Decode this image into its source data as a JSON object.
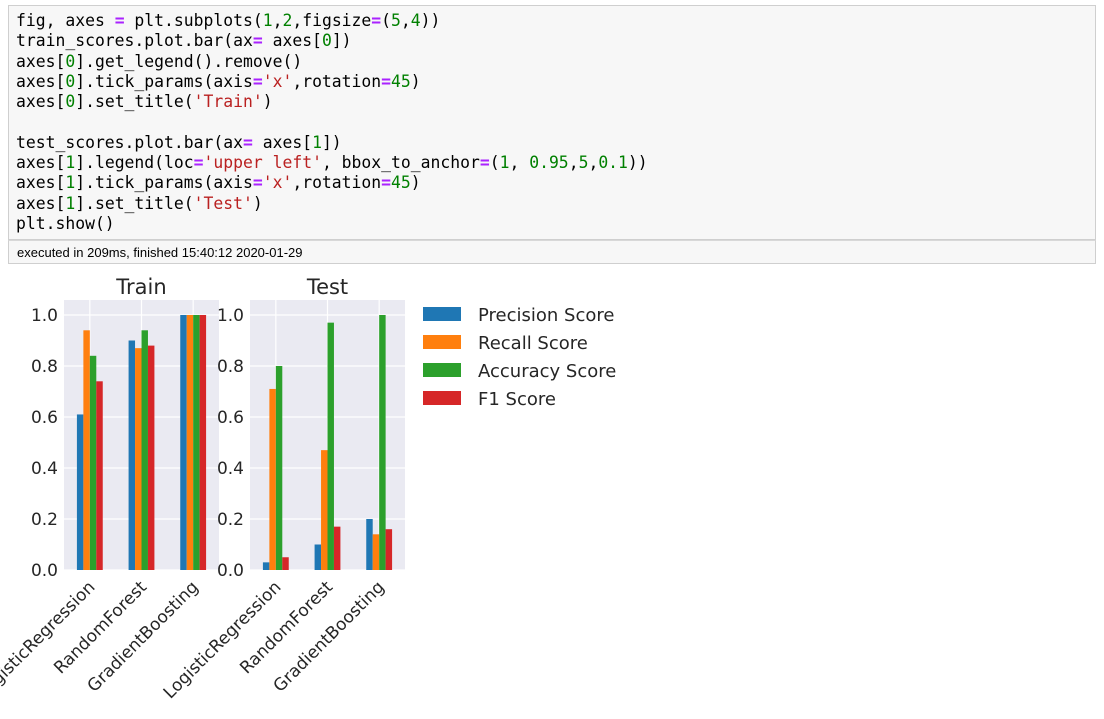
{
  "code_cell": {
    "lines": [
      [
        [
          "fig, axes ",
          "plain"
        ],
        [
          "=",
          "op"
        ],
        [
          " plt.subplots(",
          "plain"
        ],
        [
          "1",
          "num"
        ],
        [
          ",",
          "plain"
        ],
        [
          "2",
          "num"
        ],
        [
          ",figsize",
          "plain"
        ],
        [
          "=",
          "op"
        ],
        [
          "(",
          "plain"
        ],
        [
          "5",
          "num"
        ],
        [
          ",",
          "plain"
        ],
        [
          "4",
          "num"
        ],
        [
          "))",
          "plain"
        ]
      ],
      [
        [
          "train_scores.plot.bar(ax",
          "plain"
        ],
        [
          "=",
          "op"
        ],
        [
          " axes[",
          "plain"
        ],
        [
          "0",
          "num"
        ],
        [
          "])",
          "plain"
        ]
      ],
      [
        [
          "axes[",
          "plain"
        ],
        [
          "0",
          "num"
        ],
        [
          "].get_legend().remove()",
          "plain"
        ]
      ],
      [
        [
          "axes[",
          "plain"
        ],
        [
          "0",
          "num"
        ],
        [
          "].tick_params(axis",
          "plain"
        ],
        [
          "=",
          "op"
        ],
        [
          "'x'",
          "str"
        ],
        [
          ",rotation",
          "plain"
        ],
        [
          "=",
          "op"
        ],
        [
          "45",
          "num"
        ],
        [
          ")",
          "plain"
        ]
      ],
      [
        [
          "axes[",
          "plain"
        ],
        [
          "0",
          "num"
        ],
        [
          "].set_title(",
          "plain"
        ],
        [
          "'Train'",
          "str"
        ],
        [
          ")",
          "plain"
        ]
      ],
      [
        [
          "",
          "plain"
        ]
      ],
      [
        [
          "test_scores.plot.bar(ax",
          "plain"
        ],
        [
          "=",
          "op"
        ],
        [
          " axes[",
          "plain"
        ],
        [
          "1",
          "num"
        ],
        [
          "])",
          "plain"
        ]
      ],
      [
        [
          "axes[",
          "plain"
        ],
        [
          "1",
          "num"
        ],
        [
          "].legend(loc",
          "plain"
        ],
        [
          "=",
          "op"
        ],
        [
          "'upper left'",
          "str"
        ],
        [
          ", bbox_to_anchor",
          "plain"
        ],
        [
          "=",
          "op"
        ],
        [
          "(",
          "plain"
        ],
        [
          "1",
          "num"
        ],
        [
          ", ",
          "plain"
        ],
        [
          "0.95",
          "num"
        ],
        [
          ",",
          "plain"
        ],
        [
          "5",
          "num"
        ],
        [
          ",",
          "plain"
        ],
        [
          "0.1",
          "num"
        ],
        [
          "))",
          "plain"
        ]
      ],
      [
        [
          "axes[",
          "plain"
        ],
        [
          "1",
          "num"
        ],
        [
          "].tick_params(axis",
          "plain"
        ],
        [
          "=",
          "op"
        ],
        [
          "'x'",
          "str"
        ],
        [
          ",rotation",
          "plain"
        ],
        [
          "=",
          "op"
        ],
        [
          "45",
          "num"
        ],
        [
          ")",
          "plain"
        ]
      ],
      [
        [
          "axes[",
          "plain"
        ],
        [
          "1",
          "num"
        ],
        [
          "].set_title(",
          "plain"
        ],
        [
          "'Test'",
          "str"
        ],
        [
          ")",
          "plain"
        ]
      ],
      [
        [
          "plt.show()",
          "plain"
        ]
      ]
    ]
  },
  "status": {
    "text": "executed in 209ms, finished 15:40:12 2020-01-29"
  },
  "colors": {
    "axes_bg": "#eaeaf2",
    "grid": "#ffffff",
    "text": "#262626",
    "series": [
      "#1f77b4",
      "#ff7f0e",
      "#2ca02c",
      "#d62728"
    ]
  },
  "chart_data": [
    {
      "type": "bar",
      "title": "Train",
      "categories": [
        "LogisticRegression",
        "RandomForest",
        "GradientBoosting"
      ],
      "series": [
        {
          "name": "Precision Score",
          "values": [
            0.61,
            0.9,
            1.0
          ]
        },
        {
          "name": "Recall Score",
          "values": [
            0.94,
            0.87,
            1.0
          ]
        },
        {
          "name": "Accuracy Score",
          "values": [
            0.84,
            0.94,
            1.0
          ]
        },
        {
          "name": "F1 Score",
          "values": [
            0.74,
            0.88,
            1.0
          ]
        }
      ],
      "ylim": [
        0,
        1.0
      ],
      "yticks": [
        "0.0",
        "0.2",
        "0.4",
        "0.6",
        "0.8",
        "1.0"
      ],
      "grid": true,
      "legend": "none"
    },
    {
      "type": "bar",
      "title": "Test",
      "categories": [
        "LogisticRegression",
        "RandomForest",
        "GradientBoosting"
      ],
      "series": [
        {
          "name": "Precision Score",
          "values": [
            0.03,
            0.1,
            0.2
          ]
        },
        {
          "name": "Recall Score",
          "values": [
            0.71,
            0.47,
            0.14
          ]
        },
        {
          "name": "Accuracy Score",
          "values": [
            0.8,
            0.97,
            1.0
          ]
        },
        {
          "name": "F1 Score",
          "values": [
            0.05,
            0.17,
            0.16
          ]
        }
      ],
      "ylim": [
        0,
        1.0
      ],
      "yticks": [
        "0.0",
        "0.2",
        "0.4",
        "0.6",
        "0.8",
        "1.0"
      ],
      "grid": true,
      "legend": "upper left, outside right"
    }
  ]
}
